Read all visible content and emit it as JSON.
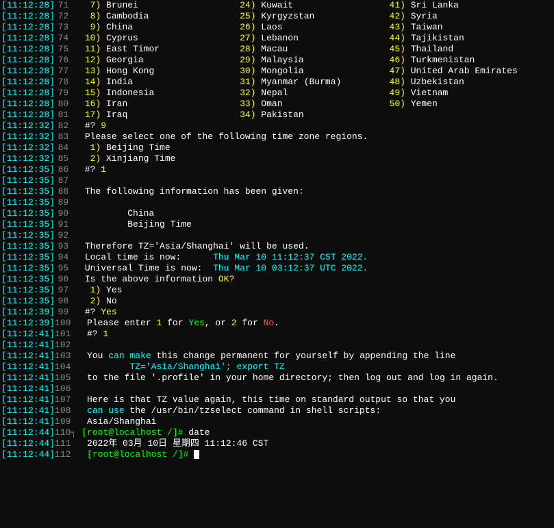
{
  "terminal": {
    "lines": [
      {
        "ts": "[11:12:28]",
        "num": "71",
        "indicator": " ",
        "content": "  7) Brunei                   24) Kuwait                  41) Sri Lanka"
      },
      {
        "ts": "[11:12:28]",
        "num": "72",
        "indicator": " ",
        "content": "  8) Cambodia                 25) Kyrgyzstan              42) Syria"
      },
      {
        "ts": "[11:12:28]",
        "num": "73",
        "indicator": " ",
        "content": "  9) China                    26) Laos                    43) Taiwan"
      },
      {
        "ts": "[11:12:28]",
        "num": "74",
        "indicator": " ",
        "content": " 10) Cyprus                   27) Lebanon                 44) Tajikistan"
      },
      {
        "ts": "[11:12:28]",
        "num": "75",
        "indicator": " ",
        "content": " 11) East Timor               28) Macau                   45) Thailand"
      },
      {
        "ts": "[11:12:28]",
        "num": "76",
        "indicator": " ",
        "content": " 12) Georgia                  29) Malaysia                46) Turkmenistan"
      },
      {
        "ts": "[11:12:28]",
        "num": "77",
        "indicator": " ",
        "content": " 13) Hong Kong                30) Mongolia                47) United Arab Emirates"
      },
      {
        "ts": "[11:12:28]",
        "num": "78",
        "indicator": " ",
        "content": " 14) India                    31) Myanmar (Burma)         48) Uzbekistan"
      },
      {
        "ts": "[11:12:28]",
        "num": "79",
        "indicator": " ",
        "content": " 15) Indonesia                32) Nepal                   49) Vietnam"
      },
      {
        "ts": "[11:12:28]",
        "num": "80",
        "indicator": " ",
        "content": " 16) Iran                     33) Oman                    50) Yemen"
      },
      {
        "ts": "[11:12:28]",
        "num": "81",
        "indicator": " ",
        "content": " 17) Iraq                     34) Pakistan"
      },
      {
        "ts": "[11:12:32]",
        "num": "82",
        "indicator": " ",
        "content": " #? 9",
        "special": "prompt_9"
      },
      {
        "ts": "[11:12:32]",
        "num": "83",
        "indicator": " ",
        "content": " Please select one of the following time zone regions."
      },
      {
        "ts": "[11:12:32]",
        "num": "84",
        "indicator": " ",
        "content": "  1) Beijing Time"
      },
      {
        "ts": "[11:12:32]",
        "num": "85",
        "indicator": " ",
        "content": "  2) Xinjiang Time"
      },
      {
        "ts": "[11:12:35]",
        "num": "86",
        "indicator": " ",
        "content": " #? 1",
        "special": "prompt_1"
      },
      {
        "ts": "[11:12:35]",
        "num": "87",
        "indicator": " ",
        "content": ""
      },
      {
        "ts": "[11:12:35]",
        "num": "88",
        "indicator": " ",
        "content": " The following information has been given:"
      },
      {
        "ts": "[11:12:35]",
        "num": "89",
        "indicator": " ",
        "content": ""
      },
      {
        "ts": "[11:12:35]",
        "num": "90",
        "indicator": " ",
        "content": "         China"
      },
      {
        "ts": "[11:12:35]",
        "num": "91",
        "indicator": " ",
        "content": "         Beijing Time"
      },
      {
        "ts": "[11:12:35]",
        "num": "92",
        "indicator": " ",
        "content": ""
      },
      {
        "ts": "[11:12:35]",
        "num": "93",
        "indicator": " ",
        "content": " Therefore TZ='Asia/Shanghai' will be used.",
        "special": "tz_line"
      },
      {
        "ts": "[11:12:35]",
        "num": "94",
        "indicator": " ",
        "content": " Local time is now:      Thu Mar 10 11:12:37 CST 2022.",
        "special": "local_time"
      },
      {
        "ts": "[11:12:35]",
        "num": "95",
        "indicator": " ",
        "content": " Universal Time is now:  Thu Mar 10 03:12:37 UTC 2022.",
        "special": "utc_time"
      },
      {
        "ts": "[11:12:35]",
        "num": "96",
        "indicator": " ",
        "content": " Is the above information OK?",
        "special": "ok_question"
      },
      {
        "ts": "[11:12:35]",
        "num": "97",
        "indicator": " ",
        "content": "  1) Yes"
      },
      {
        "ts": "[11:12:35]",
        "num": "98",
        "indicator": " ",
        "content": "  2) No"
      },
      {
        "ts": "[11:12:39]",
        "num": "99",
        "indicator": " ",
        "content": " #? Yes",
        "special": "prompt_yes"
      },
      {
        "ts": "[11:12:39]",
        "num": "100",
        "indicator": " ",
        "content": " Please enter 1 for Yes, or 2 for No.",
        "special": "enter_yn"
      },
      {
        "ts": "[11:12:41]",
        "num": "101",
        "indicator": " ",
        "content": " #? 1",
        "special": "prompt_1b"
      },
      {
        "ts": "[11:12:41]",
        "num": "102",
        "indicator": " ",
        "content": ""
      },
      {
        "ts": "[11:12:41]",
        "num": "103",
        "indicator": " ",
        "content": " You can make this change permanent for yourself by appending the line",
        "special": "you_can"
      },
      {
        "ts": "[11:12:41]",
        "num": "104",
        "indicator": " ",
        "content": "         TZ='Asia/Shanghai'; export TZ",
        "special": "tz_export"
      },
      {
        "ts": "[11:12:41]",
        "num": "105",
        "indicator": " ",
        "content": " to the file '.profile' in your home directory; then log out and log in again.",
        "special": "profile_line"
      },
      {
        "ts": "[11:12:41]",
        "num": "106",
        "indicator": " ",
        "content": ""
      },
      {
        "ts": "[11:12:41]",
        "num": "107",
        "indicator": " ",
        "content": " Here is that TZ value again, this time on standard output so that you"
      },
      {
        "ts": "[11:12:41]",
        "num": "108",
        "indicator": " ",
        "content": " can use the /usr/bin/tzselect command in shell scripts:",
        "special": "can_use"
      },
      {
        "ts": "[11:12:41]",
        "num": "109",
        "indicator": " ",
        "content": " Asia/Shanghai"
      },
      {
        "ts": "[11:12:44]",
        "num": "110",
        "indicator": "┐",
        "content": " [root@localhost /]# date",
        "special": "cmd_date"
      },
      {
        "ts": "[11:12:44]",
        "num": "111",
        "indicator": " ",
        "content": " 2022年 03月 10日 星期四 11:12:46 CST",
        "special": "date_output"
      },
      {
        "ts": "[11:12:44]",
        "num": "112",
        "indicator": " ",
        "content": " [root@localhost /]# ",
        "special": "prompt_last"
      }
    ]
  }
}
